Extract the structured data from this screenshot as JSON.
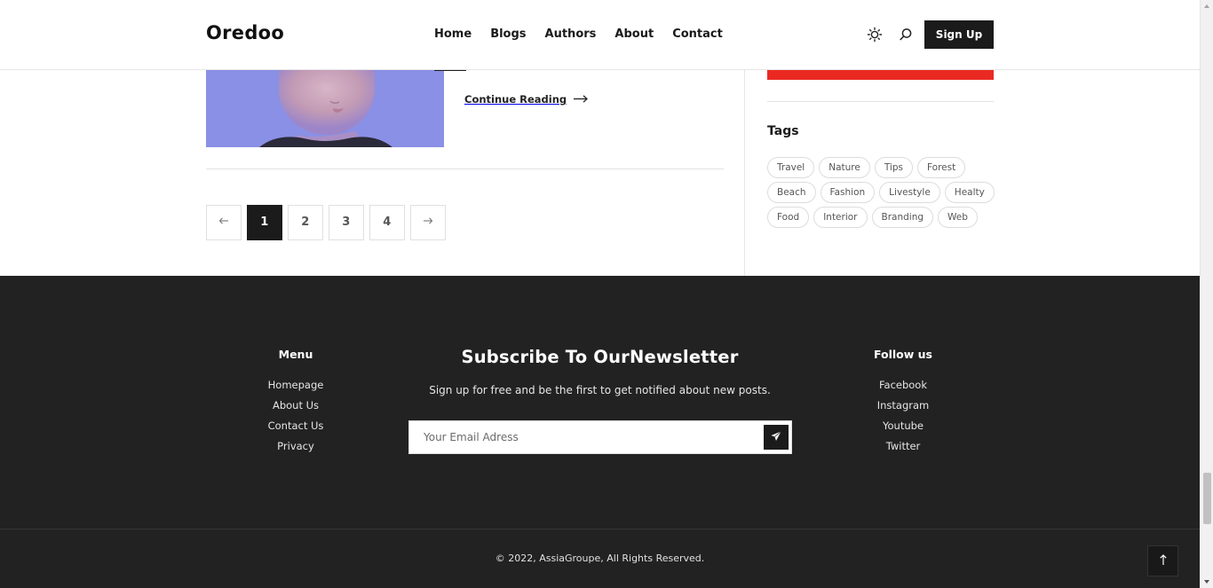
{
  "header": {
    "logo": "Oredoo",
    "nav": [
      "Home",
      "Blogs",
      "Authors",
      "About",
      "Contact"
    ],
    "theme_toggle_icon": "sun-icon",
    "search_icon": "search-icon",
    "signup_label": "Sign Up"
  },
  "post": {
    "continue_label": "Continue Reading",
    "continue_icon": "arrow-right-icon"
  },
  "pagination": {
    "prev_icon": "arrow-left-icon",
    "pages": [
      "1",
      "2",
      "3",
      "4"
    ],
    "current": "1",
    "next_icon": "arrow-right-icon"
  },
  "sidebar": {
    "accent_color": "#ea2a22",
    "tags_title": "Tags",
    "tags": [
      "Travel",
      "Nature",
      "Tips",
      "Forest",
      "Beach",
      "Fashion",
      "Livestyle",
      "Healty",
      "Food",
      "Interior",
      "Branding",
      "Web"
    ]
  },
  "footer": {
    "menu_title": "Menu",
    "menu_links": [
      "Homepage",
      "About Us",
      "Contact Us",
      "Privacy"
    ],
    "newsletter_title": "Subscribe To OurNewsletter",
    "newsletter_subtitle": "Sign up for free and be the first to get notified about new posts.",
    "email_placeholder": "Your Email Adress",
    "send_icon": "paper-plane-icon",
    "follow_title": "Follow us",
    "follow_links": [
      "Facebook",
      "Instagram",
      "Youtube",
      "Twitter"
    ],
    "copyright": "© 2022, AssiaGroupe, All Rights Reserved.",
    "back_to_top_icon": "arrow-up-icon",
    "background_color": "#222222"
  }
}
